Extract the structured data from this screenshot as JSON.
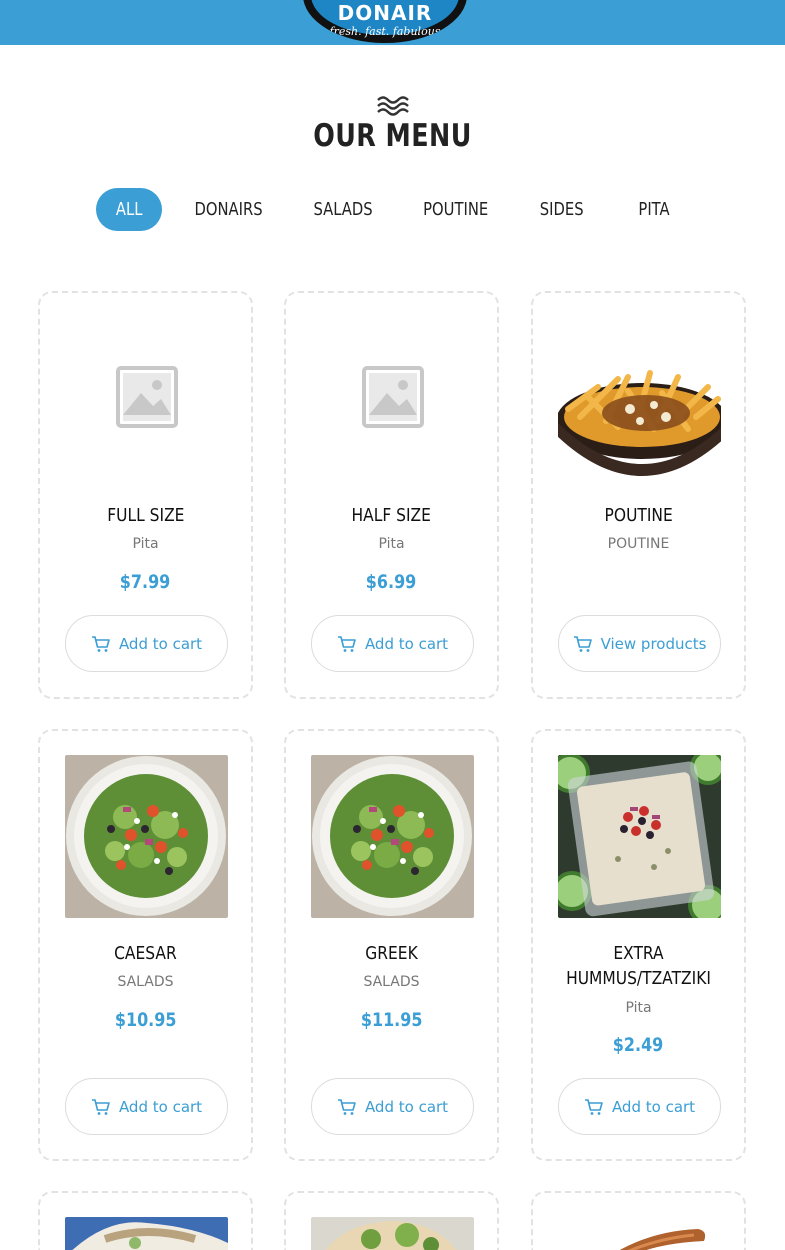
{
  "header": {
    "logo_word": "DONAIR",
    "logo_tagline": "fresh. fast. fabulous"
  },
  "menu": {
    "title": "OUR MENU",
    "tabs": [
      {
        "label": "ALL",
        "active": true
      },
      {
        "label": "DONAIRS",
        "active": false
      },
      {
        "label": "SALADS",
        "active": false
      },
      {
        "label": "POUTINE",
        "active": false
      },
      {
        "label": "SIDES",
        "active": false
      },
      {
        "label": "PITA",
        "active": false
      }
    ]
  },
  "products": [
    {
      "name": "FULL SIZE",
      "category": "Pita",
      "price": "$7.99",
      "button": "Add to cart",
      "image": "placeholder-icon"
    },
    {
      "name": "HALF SIZE",
      "category": "Pita",
      "price": "$6.99",
      "button": "Add to cart",
      "image": "placeholder-icon"
    },
    {
      "name": "POUTINE",
      "category": "POUTINE",
      "price": "",
      "button": "View products",
      "image": "poutine-photo"
    },
    {
      "name": "CAESAR",
      "category": "SALADS",
      "price": "$10.95",
      "button": "Add to cart",
      "image": "salad-photo"
    },
    {
      "name": "GREEK",
      "category": "SALADS",
      "price": "$11.95",
      "button": "Add to cart",
      "image": "salad-photo"
    },
    {
      "name": "EXTRA HUMMUS/TZATZIKI",
      "category": "Pita",
      "price": "$2.49",
      "button": "Add to cart",
      "image": "hummus-photo"
    },
    {
      "name": "",
      "category": "",
      "price": "",
      "button": "",
      "image": "wrap-photo"
    },
    {
      "name": "",
      "category": "",
      "price": "",
      "button": "",
      "image": "wrap-photo"
    },
    {
      "name": "",
      "category": "",
      "price": "",
      "button": "",
      "image": "sausage-photo"
    }
  ],
  "colors": {
    "accent": "#3b9ed4",
    "header_bg": "#3b9ed4",
    "card_border": "#e2e2e2"
  },
  "icons": {
    "cart": "shopping-cart-icon",
    "waves": "waves-icon"
  }
}
